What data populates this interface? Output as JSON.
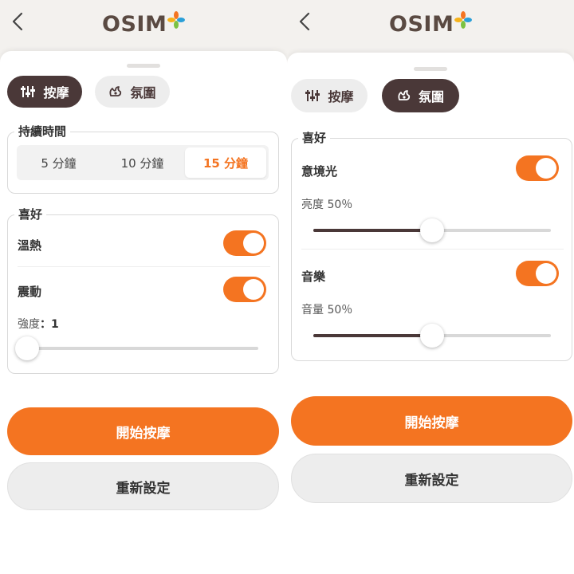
{
  "colors": {
    "accent": "#f47421",
    "dark": "#4a3838",
    "header_bg": "#f3f1ee"
  },
  "logo": {
    "text": "OSIM"
  },
  "left": {
    "tabs": [
      {
        "label": "按摩",
        "icon": "sliders-icon",
        "active": true
      },
      {
        "label": "氛圍",
        "icon": "atmosphere-icon",
        "active": false
      }
    ],
    "duration": {
      "legend": "持續時間",
      "options": [
        "5 分鐘",
        "10 分鐘",
        "15 分鐘"
      ],
      "selected": "15 分鐘"
    },
    "prefs": {
      "legend": "喜好",
      "heat": {
        "label": "溫熱",
        "on": true
      },
      "vibration": {
        "label": "震動",
        "on": true
      },
      "intensity": {
        "label": "強度",
        "separator": "：",
        "value": 1,
        "range": [
          1,
          5
        ]
      }
    },
    "start_button": "開始按摩",
    "reset_button": "重新設定"
  },
  "right": {
    "tabs": [
      {
        "label": "按摩",
        "icon": "sliders-icon",
        "active": false
      },
      {
        "label": "氛圍",
        "icon": "atmosphere-icon",
        "active": true
      }
    ],
    "prefs": {
      "legend": "喜好",
      "light": {
        "label": "意境光",
        "on": true,
        "level_label": "亮度 50％",
        "level": 50
      },
      "music": {
        "label": "音樂",
        "on": true,
        "level_label": "音量 50％",
        "level": 50
      }
    },
    "start_button": "開始按摩",
    "reset_button": "重新設定"
  }
}
